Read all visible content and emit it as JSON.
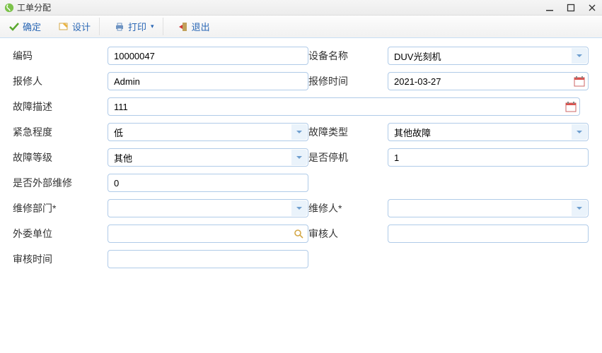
{
  "window": {
    "title": "工单分配",
    "minimize": "—",
    "maximize": "☐",
    "close": "✕"
  },
  "toolbar": {
    "confirm": "确定",
    "design": "设计",
    "print": "打印",
    "exit": "退出"
  },
  "labels": {
    "code": "编码",
    "device_name": "设备名称",
    "reporter": "报修人",
    "report_time": "报修时间",
    "fault_desc": "故障描述",
    "urgency": "紧急程度",
    "fault_type": "故障类型",
    "fault_level": "故障等级",
    "is_stopped": "是否停机",
    "is_external": "是否外部维修",
    "repair_dept": "维修部门*",
    "repairer": "维修人*",
    "outsource_unit": "外委单位",
    "auditor": "审核人",
    "audit_time": "审核时间"
  },
  "values": {
    "code": "10000047",
    "device_name": "DUV光刻机",
    "reporter": "Admin",
    "report_time": "2021-03-27",
    "fault_desc": "111",
    "urgency": "低",
    "fault_type": "其他故障",
    "fault_level": "其他",
    "is_stopped": "1",
    "is_external": "0",
    "repair_dept": "",
    "repairer": "",
    "outsource_unit": "",
    "auditor": "",
    "audit_time": ""
  }
}
